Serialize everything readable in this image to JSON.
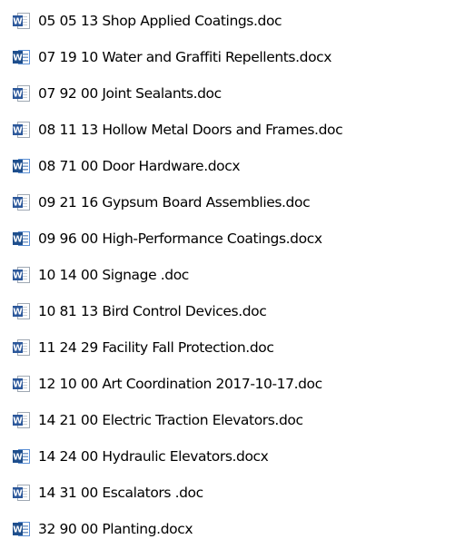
{
  "icon": {
    "name": "word-document-icon",
    "colors": {
      "blue": "#2b579a",
      "dark_blue": "#1e4e8c",
      "light_blue": "#5b8fd4",
      "page": "#ffffff",
      "lines": "#7a9cc9",
      "old_border": "#9fa8b3",
      "old_lines": "#c7cdd5"
    }
  },
  "files": [
    {
      "name": "05 05 13 Shop Applied Coatings.doc",
      "type": "doc"
    },
    {
      "name": "07 19 10 Water and Graffiti Repellents.docx",
      "type": "docx"
    },
    {
      "name": "07 92 00 Joint Sealants.doc",
      "type": "doc"
    },
    {
      "name": "08 11 13 Hollow Metal Doors and Frames.doc",
      "type": "doc"
    },
    {
      "name": "08 71 00 Door Hardware.docx",
      "type": "docx"
    },
    {
      "name": "09 21 16 Gypsum Board Assemblies.doc",
      "type": "doc"
    },
    {
      "name": "09 96 00 High-Performance Coatings.docx",
      "type": "docx"
    },
    {
      "name": "10 14 00 Signage .doc",
      "type": "doc"
    },
    {
      "name": "10 81 13 Bird Control Devices.doc",
      "type": "doc"
    },
    {
      "name": "11 24 29  Facility Fall Protection.doc",
      "type": "doc"
    },
    {
      "name": "12 10 00 Art Coordination 2017-10-17.doc",
      "type": "doc"
    },
    {
      "name": "14 21 00 Electric Traction Elevators.doc",
      "type": "doc"
    },
    {
      "name": "14 24 00 Hydraulic Elevators.docx",
      "type": "docx"
    },
    {
      "name": "14 31 00 Escalators .doc",
      "type": "doc"
    },
    {
      "name": "32 90 00 Planting.docx",
      "type": "docx"
    }
  ]
}
